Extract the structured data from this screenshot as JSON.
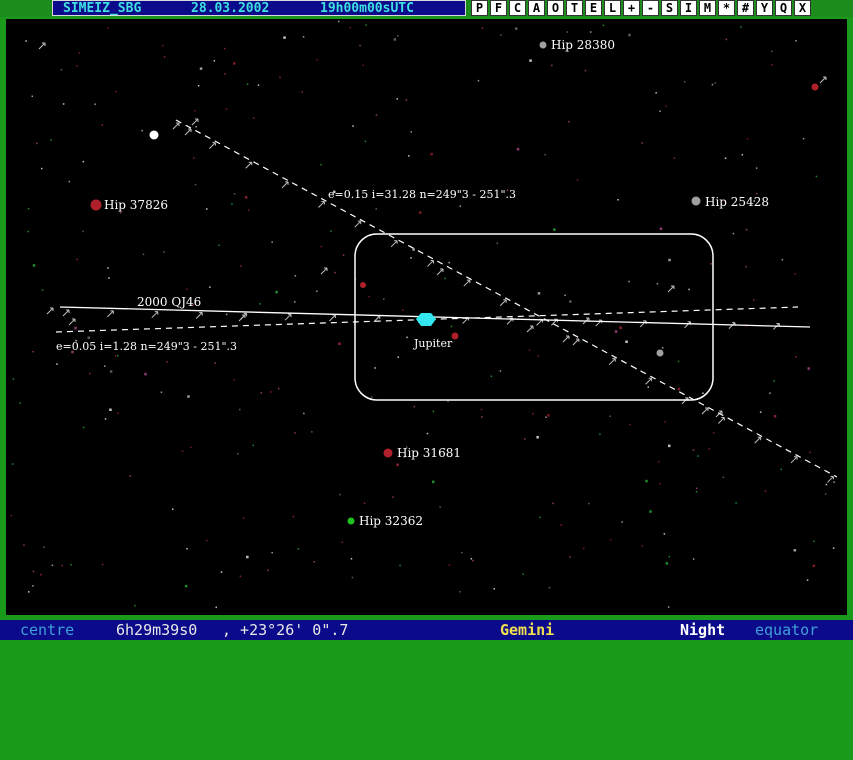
{
  "header": {
    "observatory": "SIMEIZ_SBG",
    "date": "28.03.2002",
    "time": "19h00m00sUTC"
  },
  "toolbar": [
    "P",
    "F",
    "C",
    "A",
    "O",
    "T",
    "E",
    "L",
    "+",
    "-",
    "S",
    "I",
    "M",
    "*",
    "#",
    "Y",
    "Q",
    "X"
  ],
  "sky": {
    "labels": {
      "hip28380": "Hip 28380",
      "hip37826": "Hip 37826",
      "hip25428": "Hip 25428",
      "hip31681": "Hip 31681",
      "hip32362": "Hip 32362",
      "jupiter": "Jupiter",
      "asteroid": "2000 QJ46",
      "orbit1": "e=0.15 i=31.28 n=249\"3 - 251\".3",
      "orbit2": "e=0.05 i=1.28 n=249\"3 - 251\".3"
    },
    "colors": {
      "background": "#000000",
      "jupiter": "#33e6f0",
      "hip_gray": "#a0a0a0",
      "hip_red": "#b0202a",
      "hip_green": "#20c020"
    }
  },
  "status": {
    "centre_label": "centre",
    "ra": "6h29m39s0",
    "dec": ", +23°26' 0\".7",
    "constellation": "Gemini",
    "mode": "Night",
    "coord_system": "equator"
  }
}
